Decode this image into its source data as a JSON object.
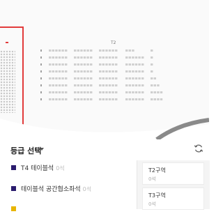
{
  "seat_map": {
    "zone_label": "T2",
    "row_count": 8,
    "colors": {
      "seat": "#cfcfcf",
      "minimap_border": "#e23b3b",
      "stage": "#8a8a8a"
    }
  },
  "grade_panel": {
    "title": "등급 선택",
    "items": [
      {
        "name": "T4 테이블석",
        "count": "0석",
        "color": "#2b1c6e"
      },
      {
        "name": "테이블석 공간협소좌석",
        "count": "0석",
        "color": "#2b1c6e"
      },
      {
        "name": "",
        "count": "",
        "color": "#e8b500"
      }
    ]
  },
  "zones": [
    {
      "name": "T2구역",
      "count": "0석"
    },
    {
      "name": "T3구역",
      "count": "0석"
    }
  ]
}
